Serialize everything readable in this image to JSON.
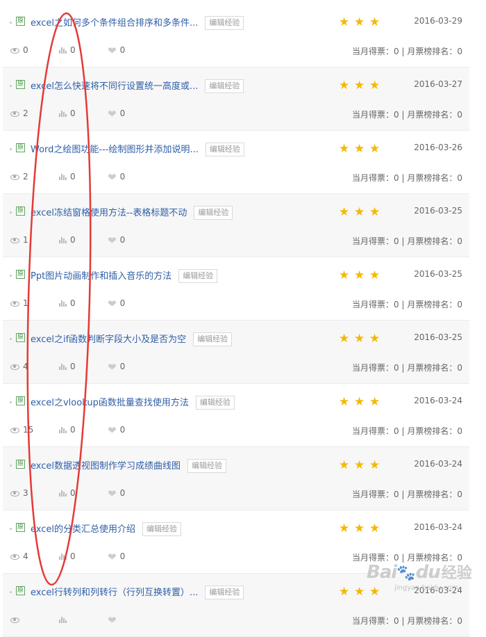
{
  "badge_text": "原",
  "edit_label": "编辑经验",
  "colors": {
    "title": "#2e5ea8",
    "star": "#f5b800",
    "oval": "#e53935"
  },
  "items": [
    {
      "title": "excel之如何多个条件组合排序和多条件...",
      "date": "2016-03-29",
      "views": "0",
      "bars": "0",
      "likes": "0",
      "votes": "当月得票：0 | 月票榜排名：0",
      "stars": 3
    },
    {
      "title": "excel怎么快速将不同行设置统一高度或...",
      "date": "2016-03-27",
      "views": "2",
      "bars": "0",
      "likes": "0",
      "votes": "当月得票：0 | 月票榜排名：0",
      "stars": 3
    },
    {
      "title": "Word之绘图功能---绘制图形并添加说明...",
      "date": "2016-03-26",
      "views": "2",
      "bars": "0",
      "likes": "0",
      "votes": "当月得票：0 | 月票榜排名：0",
      "stars": 3
    },
    {
      "title": "excel冻结窗格使用方法--表格标题不动",
      "date": "2016-03-25",
      "views": "1",
      "bars": "0",
      "likes": "0",
      "votes": "当月得票：0 | 月票榜排名：0",
      "stars": 3
    },
    {
      "title": "Ppt图片动画制作和插入音乐的方法",
      "date": "2016-03-25",
      "views": "1",
      "bars": "0",
      "likes": "0",
      "votes": "当月得票：0 | 月票榜排名：0",
      "stars": 3
    },
    {
      "title": "excel之if函数判断字段大小及是否为空",
      "date": "2016-03-25",
      "views": "4",
      "bars": "0",
      "likes": "0",
      "votes": "当月得票：0 | 月票榜排名：0",
      "stars": 3
    },
    {
      "title": "excel之vlookup函数批量查找使用方法",
      "date": "2016-03-24",
      "views": "15",
      "bars": "0",
      "likes": "0",
      "votes": "当月得票：0 | 月票榜排名：0",
      "stars": 3
    },
    {
      "title": "excel数据透视图制作学习成绩曲线图",
      "date": "2016-03-24",
      "views": "3",
      "bars": "0",
      "likes": "0",
      "votes": "当月得票：0 | 月票榜排名：0",
      "stars": 3
    },
    {
      "title": "excel的分类汇总使用介绍",
      "date": "2016-03-24",
      "views": "4",
      "bars": "0",
      "likes": "0",
      "votes": "当月得票：0 | 月票榜排名：0",
      "stars": 3
    },
    {
      "title": "excel行转列和列转行（行列互换转置）...",
      "date": "2016-03-24",
      "views": "",
      "bars": "",
      "likes": "",
      "votes": "当月得票：0 | 月票榜排名：0",
      "stars": 3
    }
  ],
  "watermark": {
    "brand": "Bai",
    "brand2": "du",
    "jingyan": "经验",
    "url": "jingyan.baidu.com"
  }
}
